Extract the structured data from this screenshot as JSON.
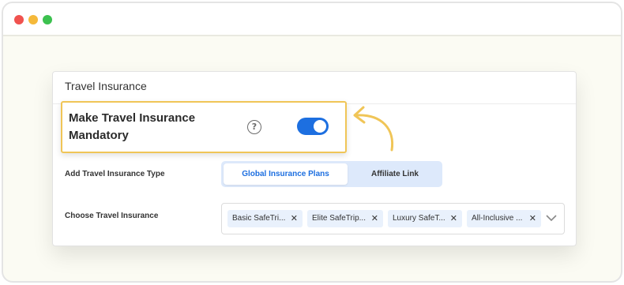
{
  "colors": {
    "window_bg": "#fbfbf3",
    "dot_red": "#f0524f",
    "dot_yellow": "#f5b93a",
    "dot_green": "#3cc14f",
    "accent_blue": "#1d6fe0",
    "highlight_yellow": "#f0c557",
    "arrow_yellow": "#f0c557"
  },
  "card": {
    "title": "Travel Insurance"
  },
  "mandatory": {
    "label": "Make Travel Insurance Mandatory",
    "help_icon": "help-circle-icon",
    "help_glyph": "?",
    "toggle_on": true
  },
  "insurance_type": {
    "label": "Add Travel Insurance Type",
    "options": [
      "Global Insurance Plans",
      "Affiliate Link"
    ],
    "selected": "Global Insurance Plans"
  },
  "choose": {
    "label": "Choose Travel Insurance",
    "chips": [
      "Basic SafeTri...",
      "Elite SafeTrip...",
      "Luxury SafeT...",
      "All-Inclusive ..."
    ],
    "remove_glyph": "✕",
    "dropdown_icon": "chevron-down-icon"
  }
}
